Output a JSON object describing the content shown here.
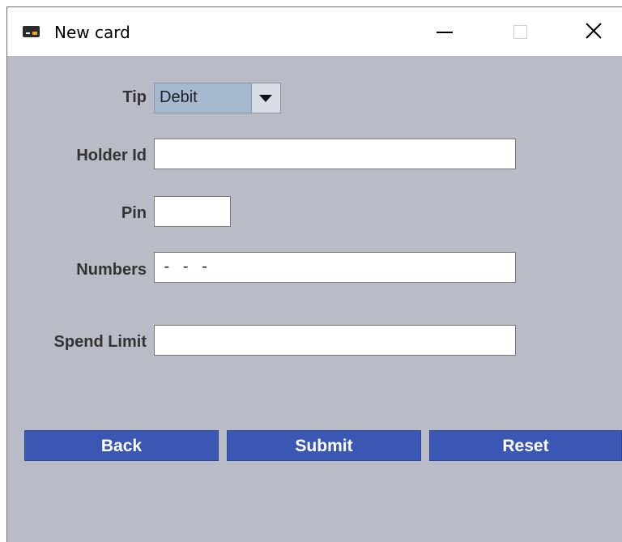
{
  "window": {
    "title": "New card",
    "icon": "credit-card-icon",
    "controls": [
      "minimize-icon",
      "maximize-icon",
      "close-icon"
    ],
    "close_glyph": "✕"
  },
  "form": {
    "tip": {
      "label": "Tip",
      "selected": "Debit"
    },
    "holder_id": {
      "label": "Holder Id",
      "value": ""
    },
    "pin": {
      "label": "Pin",
      "value": ""
    },
    "numbers": {
      "label": "Numbers",
      "value": " -   -   -"
    },
    "spend_limit": {
      "label": "Spend Limit",
      "value": ""
    }
  },
  "buttons": {
    "back": "Back",
    "submit": "Submit",
    "reset": "Reset"
  },
  "colors": {
    "background": "#b9bcc6",
    "button": "#3a57b3",
    "combo": "#a4b8d0"
  }
}
